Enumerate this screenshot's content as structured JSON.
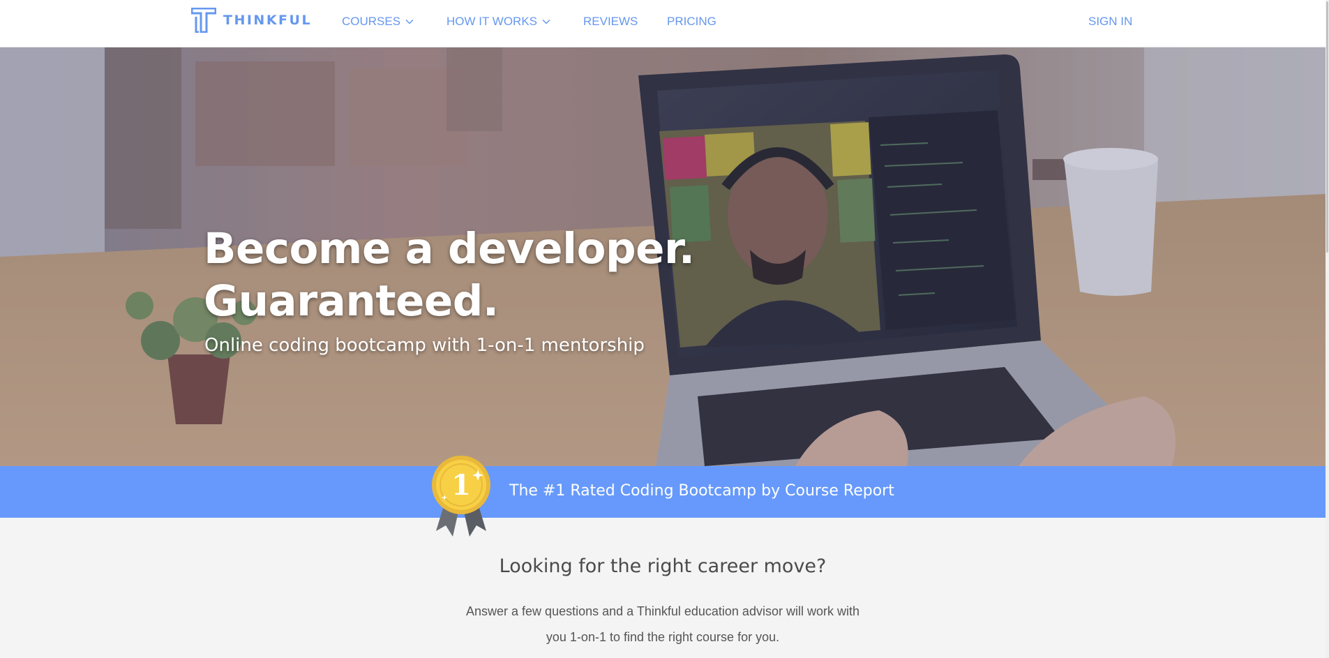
{
  "header": {
    "logo_text": "THINKFUL",
    "nav": [
      {
        "label": "COURSES",
        "has_dropdown": true
      },
      {
        "label": "HOW IT WORKS",
        "has_dropdown": true
      },
      {
        "label": "REVIEWS",
        "has_dropdown": false
      },
      {
        "label": "PRICING",
        "has_dropdown": false
      }
    ],
    "sign_in": "SIGN IN"
  },
  "hero": {
    "title_line1": "Become a developer.",
    "title_line2": "Guaranteed.",
    "subtitle": "Online coding bootcamp with 1-on-1 mentorship"
  },
  "banner": {
    "medal_number": "1",
    "text": "The #1 Rated Coding Bootcamp by Course Report"
  },
  "career": {
    "title": "Looking for the right career move?",
    "line1": "Answer a few questions and a Thinkful education advisor will work with",
    "line2": "you 1-on-1 to find the right course for you."
  },
  "colors": {
    "brand_blue": "#6597f0",
    "banner_blue": "#6699fb",
    "medal_gold": "#f7d046",
    "ribbon_gray": "#6b6f75"
  },
  "icons": [
    "thinkful-logo-icon",
    "chevron-down-icon",
    "medal-icon"
  ]
}
